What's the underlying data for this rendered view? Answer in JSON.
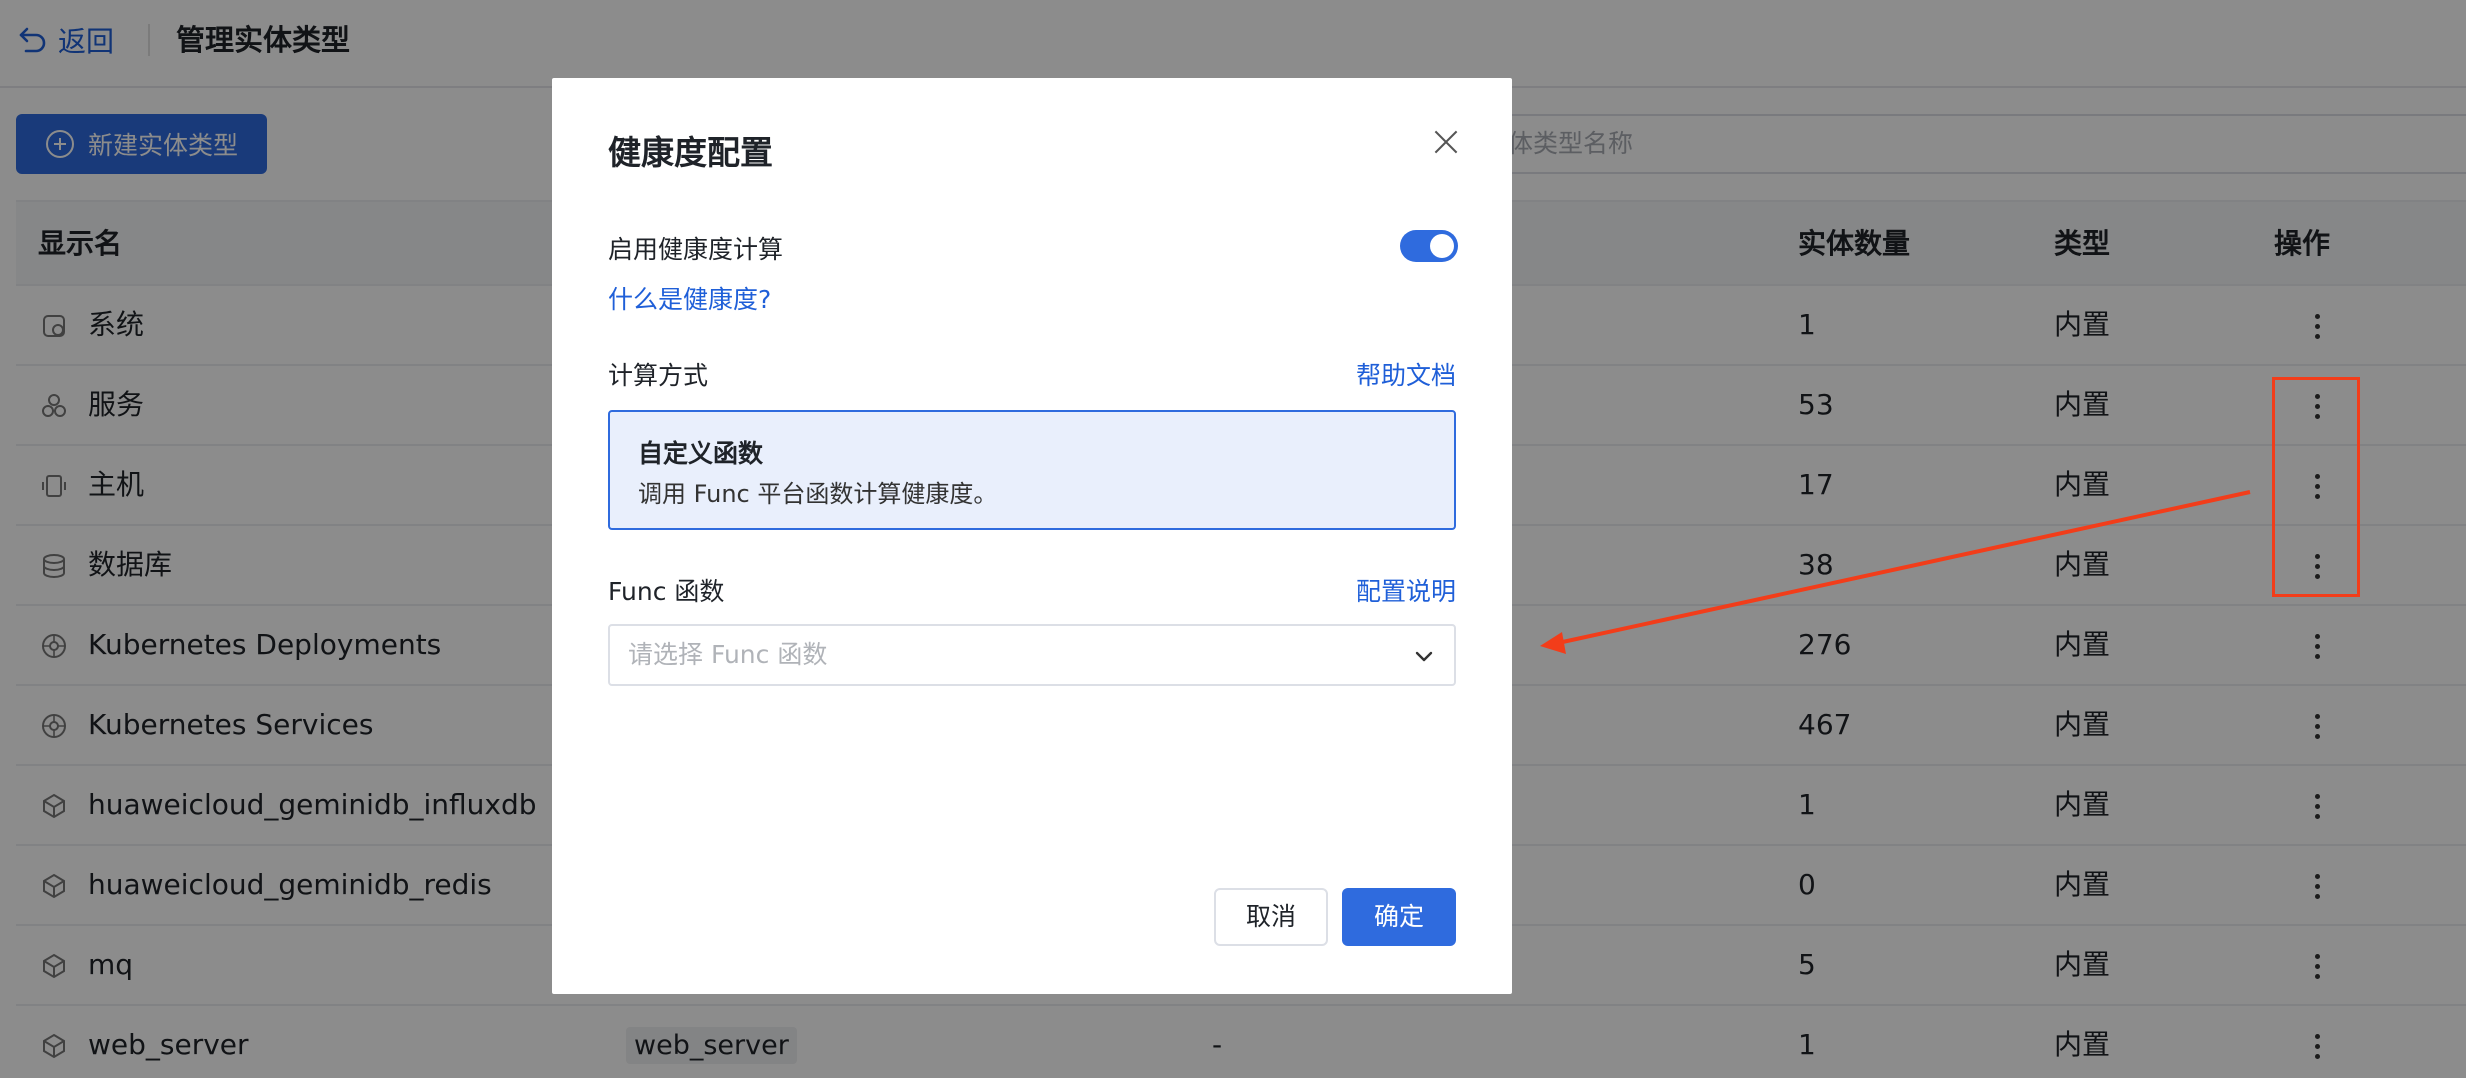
{
  "header": {
    "back_label": "返回",
    "title": "管理实体类型"
  },
  "toolbar": {
    "new_button_label": "新建实体类型",
    "search_placeholder": "体类型名称"
  },
  "table": {
    "columns": {
      "name": "显示名",
      "count": "实体数量",
      "type": "类型",
      "ops": "操作"
    },
    "rows": [
      {
        "name": "系统",
        "key": "",
        "desc": "",
        "count": "1",
        "type": "内置",
        "icon": "system-icon"
      },
      {
        "name": "服务",
        "key": "",
        "desc": "",
        "count": "53",
        "type": "内置",
        "icon": "service-icon"
      },
      {
        "name": "主机",
        "key": "",
        "desc": "",
        "count": "17",
        "type": "内置",
        "icon": "host-icon"
      },
      {
        "name": "数据库",
        "key": "",
        "desc": "",
        "count": "38",
        "type": "内置",
        "icon": "database-icon"
      },
      {
        "name": "Kubernetes Deployments",
        "key": "",
        "desc": "",
        "count": "276",
        "type": "内置",
        "icon": "kubernetes-icon"
      },
      {
        "name": "Kubernetes Services",
        "key": "",
        "desc": "",
        "count": "467",
        "type": "内置",
        "icon": "kubernetes-icon"
      },
      {
        "name": "huaweicloud_geminidb_influxdb",
        "key": "",
        "desc": "",
        "count": "1",
        "type": "内置",
        "icon": "cube-icon"
      },
      {
        "name": "huaweicloud_geminidb_redis",
        "key": "",
        "desc": "",
        "count": "0",
        "type": "内置",
        "icon": "cube-icon"
      },
      {
        "name": "mq",
        "key": "",
        "desc": "",
        "count": "5",
        "type": "内置",
        "icon": "cube-icon"
      },
      {
        "name": "web_server",
        "key": "web_server",
        "desc": "-",
        "count": "1",
        "type": "内置",
        "icon": "cube-icon"
      }
    ]
  },
  "dialog": {
    "title": "健康度配置",
    "enable_label": "启用健康度计算",
    "enable_on": true,
    "what_is_link": "什么是健康度?",
    "method_label": "计算方式",
    "help_link": "帮助文档",
    "method_card_title": "自定义函数",
    "method_card_desc": "调用 Func 平台函数计算健康度。",
    "func_label": "Func 函数",
    "config_link": "配置说明",
    "func_placeholder": "请选择 Func 函数",
    "cancel_label": "取消",
    "ok_label": "确定"
  },
  "colors": {
    "primary": "#2f6bde",
    "annotation": "#f23d1a"
  }
}
